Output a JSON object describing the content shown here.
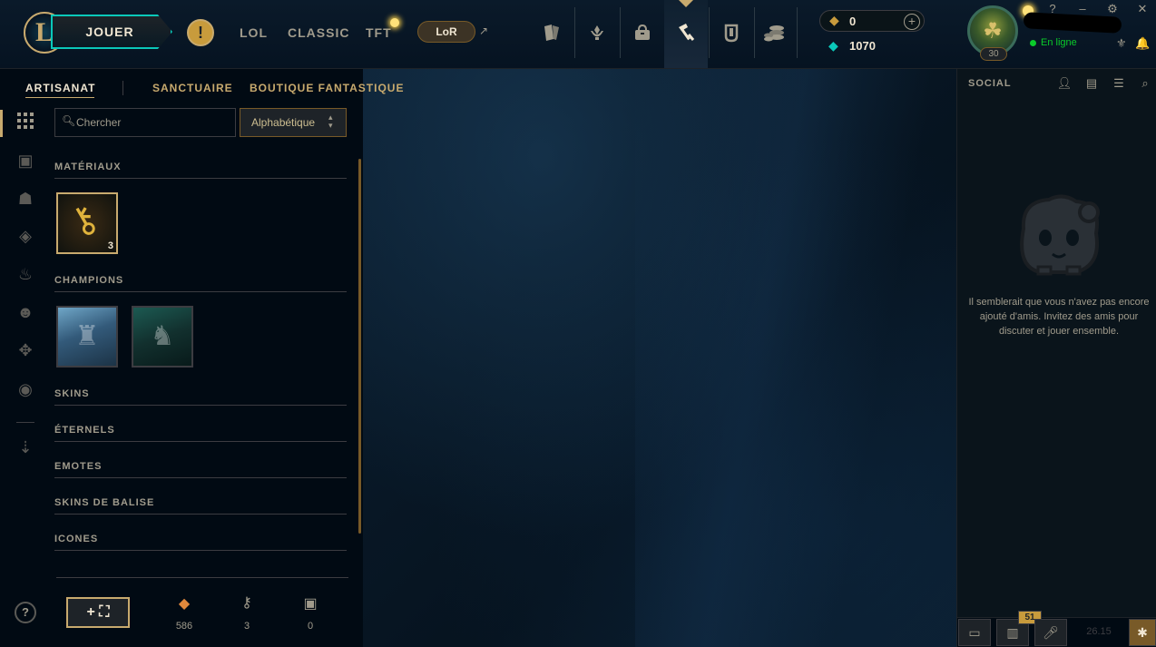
{
  "nav": {
    "play_label": "JOUER",
    "modes": [
      "LOL",
      "CLASSIC",
      "TFT"
    ],
    "lor_label": "LoR",
    "lor_arrow": "↗",
    "alert_glyph": "!",
    "logo_glyph": "L",
    "icons": [
      "cards-icon",
      "champions-icon",
      "store-icon",
      "crafting-icon",
      "collection-icon",
      "currency-icon"
    ],
    "currency": {
      "rp": "0",
      "blue_essence": "1070",
      "plus": "+"
    },
    "profile": {
      "level": "30",
      "status": "En ligne"
    },
    "window_controls": [
      "?",
      "–",
      "⚙",
      "✕"
    ]
  },
  "crafting": {
    "tabs": [
      "ARTISANAT",
      "SANCTUAIRE",
      "BOUTIQUE FANTASTIQUE"
    ],
    "search_placeholder": "Chercher",
    "sort": {
      "selected": "Alphabétique",
      "arrow": "▲▼"
    },
    "categories": {
      "materials": "MATÉRIAUX",
      "champions": "CHAMPIONS",
      "skins": "SKINS",
      "eternals": "ÉTERNELS",
      "emotes": "EMOTES",
      "ward_skins": "SKINS DE BALISE",
      "icons": "ICONES"
    },
    "materials": [
      {
        "name": "hextech-key",
        "count": "3"
      }
    ],
    "champions": [
      "champion-shard-1",
      "champion-shard-2"
    ],
    "footer": {
      "chest_btn": "+ ⛶",
      "orange_essence": "586",
      "key_fragments": "3",
      "chests": "0"
    },
    "help": "?"
  },
  "social": {
    "title": "SOCIAL",
    "empty_message": "Il semblerait que vous n'avez pas encore ajouté d'amis. Invitez des amis pour discuter et jouer ensemble.",
    "missions_count": "51",
    "clock": "26.15"
  }
}
